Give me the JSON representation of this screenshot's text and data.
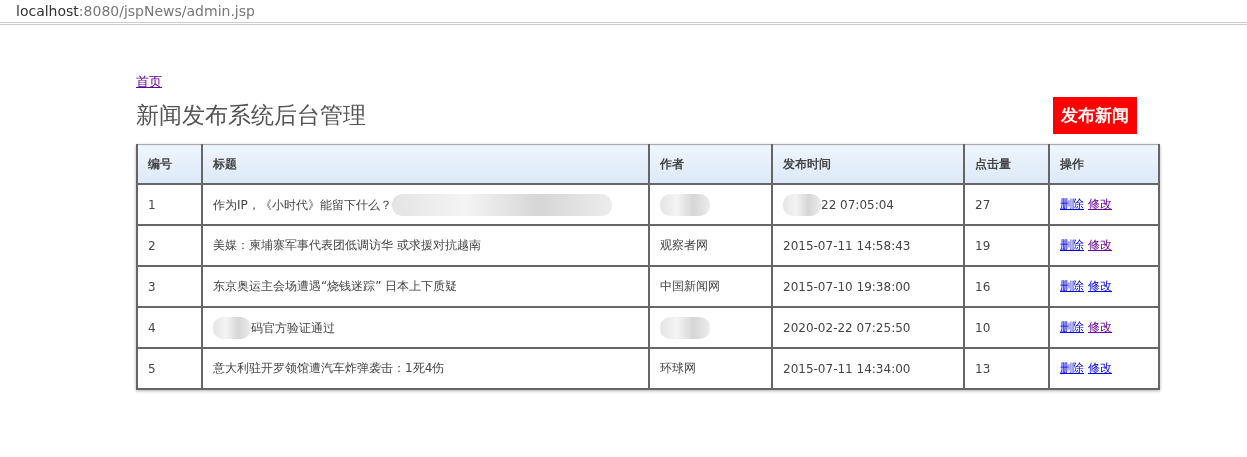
{
  "address_bar": {
    "host": "localhost",
    "path": ":8080/jspNews/admin.jsp"
  },
  "home_link": {
    "label": "首页",
    "visited": true
  },
  "title": "新闻发布系统后台管理",
  "publish_button": "发布新闻",
  "table": {
    "columns": [
      "编号",
      "标题",
      "作者",
      "发布时间",
      "点击量",
      "操作"
    ],
    "rows": [
      {
        "id": "1",
        "title": {
          "text": "作为IP，《小时代》能留下什么？",
          "blur_after": true
        },
        "author": {
          "blur_before": true
        },
        "time": {
          "text": "22 07:05:04",
          "blur_before": true
        },
        "clicks": "27",
        "actions": [
          {
            "label": "删除",
            "visited": false
          },
          {
            "label": "修改",
            "visited": true
          }
        ]
      },
      {
        "id": "2",
        "title": {
          "text": "美媒：柬埔寨军事代表团低调访华 或求援对抗越南"
        },
        "author": {
          "text": "观察者网"
        },
        "time": {
          "text": "2015-07-11 14:58:43"
        },
        "clicks": "19",
        "actions": [
          {
            "label": "删除",
            "visited": false
          },
          {
            "label": "修改",
            "visited": true
          }
        ]
      },
      {
        "id": "3",
        "title": {
          "text": "东京奥运主会场遭遇“烧钱迷踪” 日本上下质疑"
        },
        "author": {
          "text": "中国新闻网"
        },
        "time": {
          "text": "2015-07-10 19:38:00"
        },
        "clicks": "16",
        "actions": [
          {
            "label": "删除",
            "visited": false
          },
          {
            "label": "修改",
            "visited": false
          }
        ]
      },
      {
        "id": "4",
        "title": {
          "text": "码官方验证通过",
          "blur_before": true
        },
        "author": {
          "blur_before": true
        },
        "time": {
          "text": "2020-02-22 07:25:50"
        },
        "clicks": "10",
        "actions": [
          {
            "label": "删除",
            "visited": false
          },
          {
            "label": "修改",
            "visited": true
          }
        ]
      },
      {
        "id": "5",
        "title": {
          "text": "意大利驻开罗领馆遭汽车炸弹袭击：1死4伤"
        },
        "author": {
          "text": "环球网"
        },
        "time": {
          "text": "2015-07-11 14:34:00"
        },
        "clicks": "13",
        "actions": [
          {
            "label": "删除",
            "visited": false
          },
          {
            "label": "修改",
            "visited": false
          }
        ]
      }
    ]
  }
}
